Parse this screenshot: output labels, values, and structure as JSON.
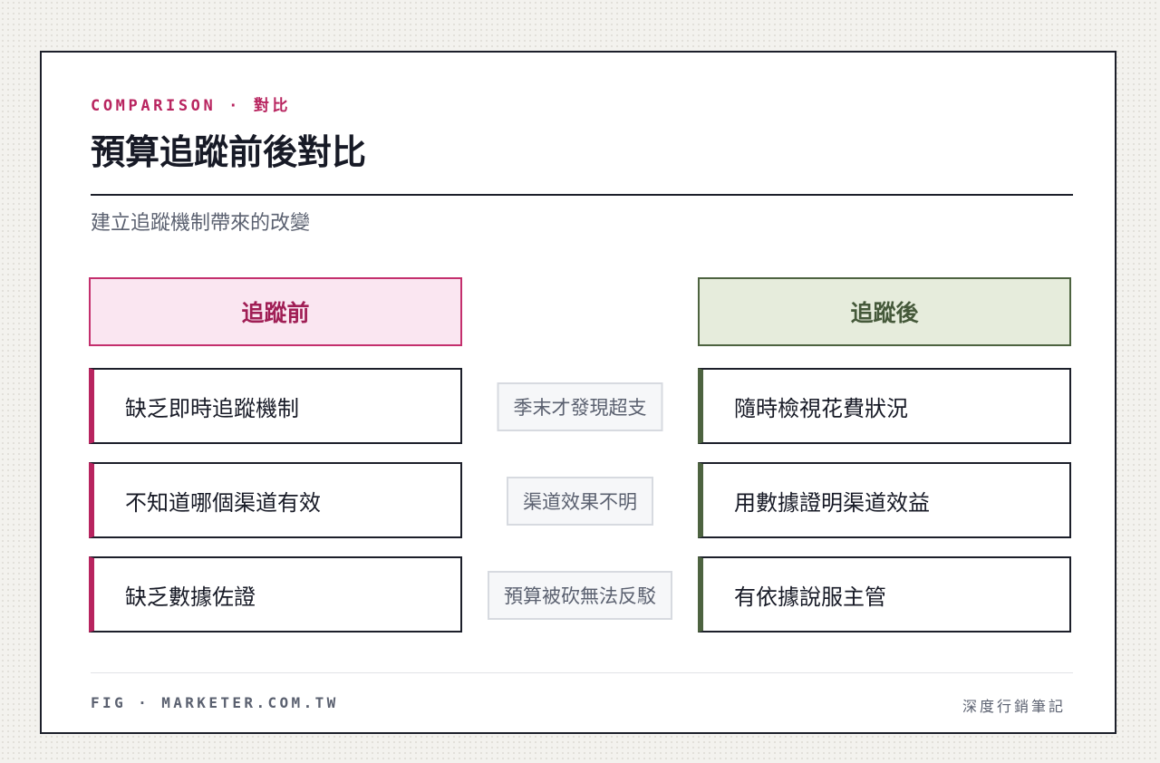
{
  "header": {
    "eyebrow": "COMPARISON · 對比",
    "title": "預算追蹤前後對比",
    "subtitle": "建立追蹤機制帶來的改變"
  },
  "columns": {
    "before": {
      "title": "追蹤前",
      "items": [
        "缺乏即時追蹤機制",
        "不知道哪個渠道有效",
        "缺乏數據佐證"
      ]
    },
    "middle": {
      "items": [
        "季末才發現超支",
        "渠道效果不明",
        "預算被砍無法反駁"
      ]
    },
    "after": {
      "title": "追蹤後",
      "items": [
        "隨時檢視花費狀況",
        "用數據證明渠道效益",
        "有依據說服主管"
      ]
    }
  },
  "footer": {
    "source": "FIG · MARKETER.COM.TW",
    "publisher": "深度行銷筆記"
  },
  "colors": {
    "before_accent": "#b8245f",
    "before_fill": "#fae6f1",
    "after_accent": "#4d6340",
    "after_fill": "#e6ecdc",
    "ink": "#171a26",
    "muted": "#5b6170"
  }
}
